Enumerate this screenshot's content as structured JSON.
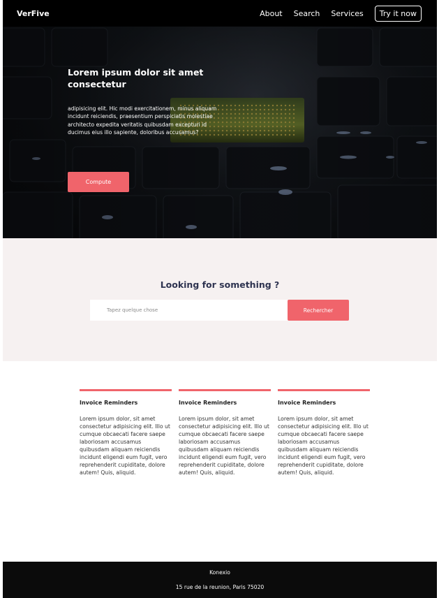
{
  "navbar": {
    "brand": "VerFive",
    "links": [
      "About",
      "Search",
      "Services"
    ],
    "cta": "Try it now"
  },
  "hero": {
    "title": "Lorem ipsum dolor sit amet consectetur",
    "text": "adipisicing elit. Hic modi exercitationem, minus aliquam incidunt reiciendis, praesentium perspiciatis molestiae architecto expedita veritatis quibusdam excepturi id ducimus eius illo sapiente, doloribus accusamus?",
    "button": "Compute"
  },
  "search": {
    "title": "Looking for something ?",
    "placeholder": "Tapez quelque chose",
    "button": "Rechercher"
  },
  "cards": [
    {
      "title": "Invoice Reminders",
      "text": "Lorem ipsum dolor, sit amet consectetur adipisicing elit. Illo ut cumque obcaecati facere saepe laboriosam accusamus quibusdam aliquam reiciendis incidunt eligendi eum fugit, vero reprehenderit cupiditate, dolore autem! Quis, aliquid."
    },
    {
      "title": "Invoice Reminders",
      "text": "Lorem ipsum dolor, sit amet consectetur adipisicing elit. Illo ut cumque obcaecati facere saepe laboriosam accusamus quibusdam aliquam reiciendis incidunt eligendi eum fugit, vero reprehenderit cupiditate, dolore autem! Quis, aliquid."
    },
    {
      "title": "Invoice Reminders",
      "text": "Lorem ipsum dolor, sit amet consectetur adipisicing elit. Illo ut cumque obcaecati facere saepe laboriosam accusamus quibusdam aliquam reiciendis incidunt eligendi eum fugit, vero reprehenderit cupiditate, dolore autem! Quis, aliquid."
    }
  ],
  "footer": {
    "company": "Konexio",
    "address": "15 rue de la reunion, Paris 75020"
  },
  "colors": {
    "accent": "#f0646b",
    "navbar_bg": "#000000",
    "search_bg": "#f6f1f1",
    "footer_bg": "#0b0b0b",
    "heading": "#2e3350"
  }
}
